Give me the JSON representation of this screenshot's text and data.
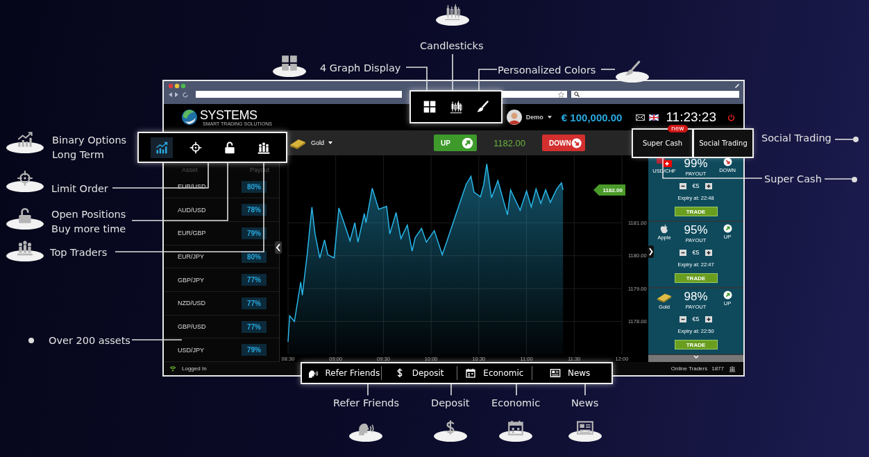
{
  "callouts": [
    {
      "lines": [
        "Candlesticks"
      ],
      "kind": "candlestick"
    },
    {
      "lines": [
        "4 Graph Display"
      ],
      "kind": "grid"
    },
    {
      "lines": [
        "Personalized Colors"
      ],
      "kind": "brush"
    },
    {
      "lines": [
        "Binary Options",
        "Long Term"
      ],
      "kind": "trend"
    },
    {
      "lines": [
        "Limit Order"
      ],
      "kind": "crosshair"
    },
    {
      "lines": [
        "Open Positions",
        "Buy more time"
      ],
      "kind": "padlock"
    },
    {
      "lines": [
        "Top Traders"
      ],
      "kind": "people"
    },
    {
      "lines": [
        "Over 200 assets"
      ],
      "kind": "dot"
    },
    {
      "lines": [
        "Social Trading"
      ],
      "kind": "dot"
    },
    {
      "lines": [
        "Super Cash"
      ],
      "kind": "dot"
    },
    {
      "lines": [
        "Refer Friends"
      ],
      "kind": "speaker"
    },
    {
      "lines": [
        "Deposit"
      ],
      "kind": "dollar"
    },
    {
      "lines": [
        "Economic"
      ],
      "kind": "calendar"
    },
    {
      "lines": [
        "News"
      ],
      "kind": "newspaper"
    }
  ],
  "app": {
    "header": {
      "logo": {
        "name": "SYSTEMS",
        "tagline": "SMART TRADING SOLUTIONS"
      },
      "account": "Demo",
      "balance": "€ 100,000.00",
      "clock": "11:23:23"
    },
    "toolbar": {
      "asset": "Gold",
      "up": "UP",
      "price": "1182.00",
      "down": "DOWN"
    },
    "display_tools": [
      {
        "kind": "grid"
      },
      {
        "kind": "candlestick"
      },
      {
        "kind": "brush"
      }
    ],
    "mode_tools": [
      {
        "kind": "trend",
        "selected": true
      },
      {
        "kind": "crosshair",
        "selected": false
      },
      {
        "kind": "padlock",
        "selected": false
      },
      {
        "kind": "people",
        "selected": false
      }
    ],
    "assets": {
      "columns": [
        "Asset",
        "Payout"
      ],
      "rows": [
        {
          "name": "EUR/USD",
          "payout": "80%"
        },
        {
          "name": "AUD/USD",
          "payout": "78%"
        },
        {
          "name": "EUR/GBP",
          "payout": "79%"
        },
        {
          "name": "EUR/JPY",
          "payout": "80%"
        },
        {
          "name": "GBP/JPY",
          "payout": "77%"
        },
        {
          "name": "NZD/USD",
          "payout": "77%"
        },
        {
          "name": "GBP/USD",
          "payout": "77%"
        },
        {
          "name": "USD/JPY",
          "payout": "79%"
        }
      ]
    },
    "chart": {
      "price_tag": "1182.00",
      "chart_data": {
        "type": "area",
        "grid": true,
        "xlim": [
          8.5,
          12
        ],
        "ylim": [
          1177,
          1183.05
        ],
        "x": [
          8.5,
          8.517,
          8.567,
          8.633,
          8.65,
          8.7,
          8.75,
          8.783,
          8.833,
          8.883,
          8.917,
          8.983,
          9.033,
          9.083,
          9.15,
          9.2,
          9.233,
          9.3,
          9.317,
          9.383,
          9.45,
          9.533,
          9.567,
          9.633,
          9.683,
          9.75,
          9.8,
          9.833,
          9.9,
          9.95,
          10.033,
          10.117,
          10.167,
          10.267,
          10.367,
          10.417,
          10.45,
          10.517,
          10.55,
          10.583,
          10.633,
          10.7,
          10.8,
          10.833,
          10.933,
          11.0,
          11.05,
          11.1,
          11.15,
          11.2,
          11.25,
          11.317,
          11.367,
          11.383
        ],
        "series": [
          {
            "color": "#29b6e8",
            "values": [
              1177.38,
              1178.17,
              1178.0,
              1179.2,
              1178.8,
              1180.03,
              1181.48,
              1180.66,
              1179.93,
              1180.48,
              1180.03,
              1179.93,
              1181.45,
              1181.03,
              1180.45,
              1181.0,
              1180.41,
              1181.28,
              1181.0,
              1182.05,
              1181.41,
              1181.5,
              1180.66,
              1181.31,
              1180.52,
              1180.93,
              1180.14,
              1180.55,
              1180.83,
              1180.41,
              1180.76,
              1180.03,
              1180.45,
              1181.31,
              1182.17,
              1182.41,
              1181.93,
              1181.79,
              1182.14,
              1182.79,
              1181.76,
              1182.28,
              1181.24,
              1182.0,
              1181.38,
              1181.97,
              1181.48,
              1182.03,
              1181.59,
              1182.0,
              1181.62,
              1182.03,
              1182.21,
              1182.0
            ]
          }
        ],
        "xticks": [
          {
            "value": 8.5,
            "label": "08:30"
          },
          {
            "value": 9,
            "label": "09:00"
          },
          {
            "value": 9.5,
            "label": "09:30"
          },
          {
            "value": 10,
            "label": "10:00"
          },
          {
            "value": 10.5,
            "label": "10:30"
          },
          {
            "value": 11,
            "label": "11:00"
          },
          {
            "value": 11.5,
            "label": "11:30"
          },
          {
            "value": 12,
            "label": "12:00"
          }
        ],
        "yticks": [
          {
            "value": 1178,
            "label": "1178.00"
          },
          {
            "value": 1179,
            "label": "1179.00"
          },
          {
            "value": 1180,
            "label": "1180.00"
          },
          {
            "value": 1181,
            "label": "1181.00"
          }
        ]
      }
    },
    "feature_tabs": [
      {
        "label": "Super Cash",
        "badge": "new"
      },
      {
        "label": "Social Trading"
      }
    ],
    "trade_cards": [
      {
        "asset": "USD/CHF",
        "payout": "99%",
        "payout_label": "PAYOUT",
        "kind": "down",
        "direction_label": "DOWN",
        "amount": "€5",
        "expiry": "Expiry at: 22:48",
        "button": "TRADE"
      },
      {
        "asset": "Apple",
        "payout": "95%",
        "payout_label": "PAYOUT",
        "kind": "up",
        "direction_label": "UP",
        "amount": "€5",
        "expiry": "Expiry at: 22:47",
        "button": "TRADE"
      },
      {
        "asset": "Gold",
        "payout": "98%",
        "payout_label": "PAYOUT",
        "kind": "up",
        "direction_label": "UP",
        "amount": "€5",
        "expiry": "Expiry at: 22:50",
        "button": "TRADE"
      }
    ],
    "bottom_bar": [
      {
        "label": "Refer Friends",
        "kind": "speaker"
      },
      {
        "label": "Deposit",
        "kind": "dollar"
      },
      {
        "label": "Economic",
        "kind": "calendar"
      },
      {
        "label": "News",
        "kind": "newspaper"
      }
    ],
    "status": {
      "connection": "Logged In",
      "online_label": "Online Traders",
      "online_count": "1877"
    }
  }
}
